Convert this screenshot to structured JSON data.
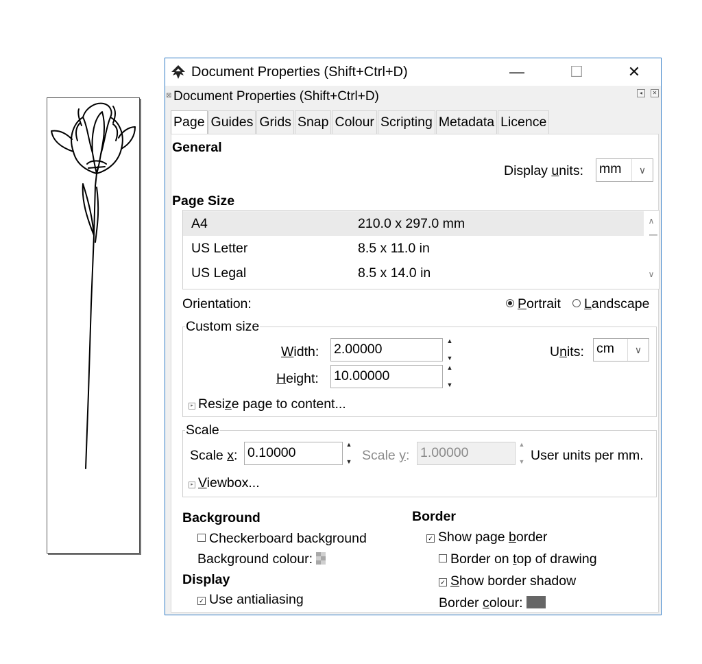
{
  "window": {
    "title": "Document Properties (Shift+Ctrl+D)",
    "minimize_glyph": "—",
    "maximize_glyph": "☐",
    "close_glyph": "✕"
  },
  "dock": {
    "title": "Document Properties (Shift+Ctrl+D)",
    "grip_glyph": "⊠",
    "iconify_glyph": "◂",
    "close_glyph": "✕"
  },
  "tabs": [
    "Page",
    "Guides",
    "Grids",
    "Snap",
    "Colour",
    "Scripting",
    "Metadata",
    "Licence"
  ],
  "general": {
    "heading": "General",
    "display_units_pre": "Display ",
    "display_units_u": "u",
    "display_units_post": "nits:",
    "display_units_value": "mm"
  },
  "page_size": {
    "heading": "Page Size",
    "rows": [
      {
        "name": "A4",
        "size": "210.0 x 297.0 mm"
      },
      {
        "name": "US Letter",
        "size": "8.5 x 11.0 in"
      },
      {
        "name": "US Legal",
        "size": "8.5 x 14.0 in"
      }
    ],
    "selected_row": 0
  },
  "orientation": {
    "label": "Orientation:",
    "portrait_u": "P",
    "portrait_rest": "ortrait",
    "landscape_u": "L",
    "landscape_rest": "andscape",
    "selected": "portrait"
  },
  "custom_size": {
    "label": "Custom size",
    "width_u": "W",
    "width_rest": "idth:",
    "width_value": "2.00000",
    "height_u": "H",
    "height_rest": "eight:",
    "height_value": "10.00000",
    "units_pre": "U",
    "units_u": "n",
    "units_post": "its:",
    "units_value": "cm",
    "resize_pre": "Resi",
    "resize_u": "z",
    "resize_post": "e page to content..."
  },
  "scale": {
    "label": "Scale",
    "scale_x_pre": "Scale ",
    "scale_x_u": "x",
    "scale_x_post": ":",
    "scale_x_value": "0.10000",
    "scale_y_pre": "Scale ",
    "scale_y_u": "y",
    "scale_y_post": ":",
    "scale_y_value": "1.00000",
    "user_units": "User units per mm.",
    "viewbox_u": "V",
    "viewbox_rest": "iewbox..."
  },
  "background": {
    "heading": "Background",
    "checkerboard": "Checkerboard background",
    "checkerboard_checked": false,
    "colour_label": "Background colour:"
  },
  "display": {
    "heading": "Display",
    "antialiasing": "Use antialiasing",
    "antialiasing_checked": true
  },
  "border": {
    "heading": "Border",
    "show_pre": "Show page ",
    "show_u": "b",
    "show_post": "order",
    "show_checked": true,
    "ontop_pre": "Border on ",
    "ontop_u": "t",
    "ontop_post": "op of drawing",
    "ontop_checked": false,
    "shadow_u": "S",
    "shadow_post": "how border shadow",
    "shadow_checked": true,
    "colour_pre": "Border ",
    "colour_u": "c",
    "colour_post": "olour:",
    "colour_value": "#666666"
  },
  "colors": {
    "accent": "#2b78c4",
    "window_bg": "#f0f0f0",
    "panel_bg": "#ffffff"
  }
}
